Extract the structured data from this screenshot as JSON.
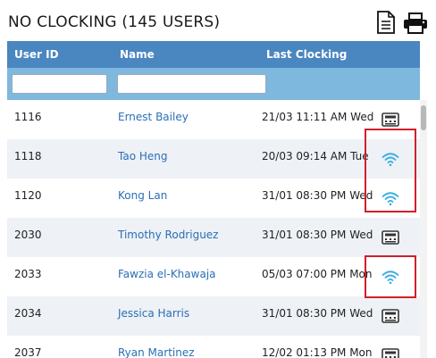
{
  "header": {
    "title": "NO CLOCKING (145 USERS)"
  },
  "columns": {
    "user_id": "User ID",
    "name": "Name",
    "last_clocking": "Last Clocking"
  },
  "filters": {
    "user_id": "",
    "name": ""
  },
  "rows": [
    {
      "id": "1116",
      "name": "Ernest Bailey",
      "last": "21/03 11:11 AM Wed",
      "device": "terminal-icon"
    },
    {
      "id": "1118",
      "name": "Tao Heng",
      "last": "20/03 09:14 AM Tue",
      "device": "wifi-icon"
    },
    {
      "id": "1120",
      "name": "Kong Lan",
      "last": "31/01 08:30 PM Wed",
      "device": "wifi-icon"
    },
    {
      "id": "2030",
      "name": "Timothy Rodriguez",
      "last": "31/01 08:30 PM Wed",
      "device": "terminal-icon"
    },
    {
      "id": "2033",
      "name": "Fawzia el-Khawaja",
      "last": "05/03 07:00 PM Mon",
      "device": "wifi-icon"
    },
    {
      "id": "2034",
      "name": "Jessica Harris",
      "last": "31/01 08:30 PM Wed",
      "device": "terminal-icon"
    },
    {
      "id": "2037",
      "name": "Ryan Martinez",
      "last": "12/02 01:13 PM Mon",
      "device": "terminal-icon"
    }
  ],
  "colors": {
    "header_blue": "#4a86c0",
    "filter_blue": "#7fb8de",
    "link_blue": "#2a6fb5",
    "wifi_cyan": "#3aaee0",
    "highlight_red": "#d0202a"
  }
}
